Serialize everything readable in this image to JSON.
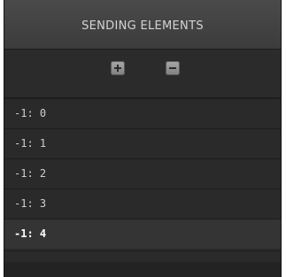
{
  "header": {
    "title": "SENDING ELEMENTS"
  },
  "toolbar": {
    "add_icon": "plus-icon",
    "remove_icon": "minus-icon"
  },
  "list": {
    "selected_index": 4,
    "items": [
      {
        "label": "-1: 0"
      },
      {
        "label": "-1: 1"
      },
      {
        "label": "-1: 2"
      },
      {
        "label": "-1: 3"
      },
      {
        "label": "-1: 4"
      }
    ]
  }
}
